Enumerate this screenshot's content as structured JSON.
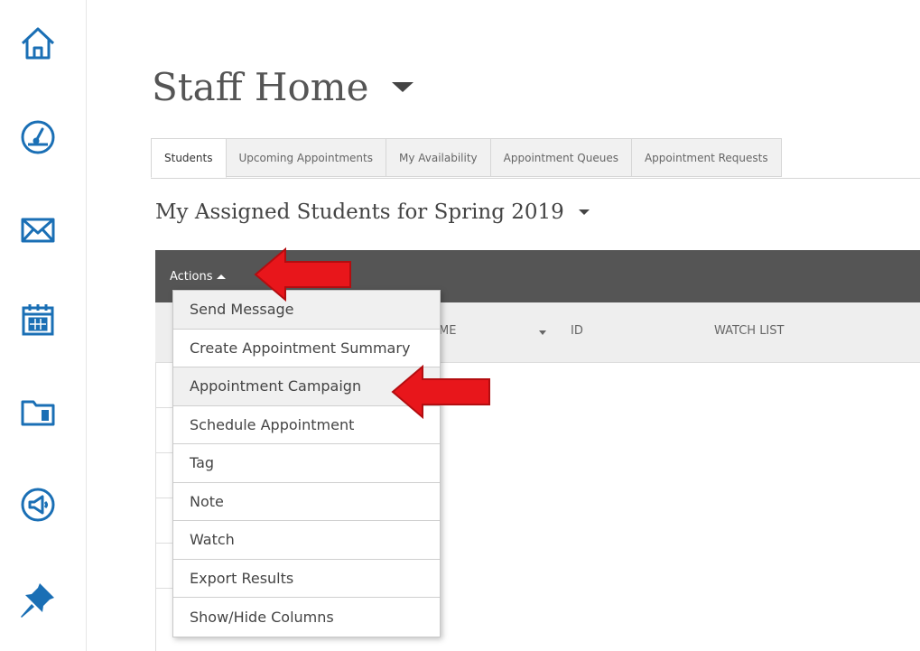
{
  "nav": {
    "icons": [
      "home-icon",
      "dashboard-icon",
      "mail-icon",
      "calendar-icon",
      "folder-icon",
      "megaphone-icon",
      "pin-icon"
    ],
    "icon_color": "#1a6fb5"
  },
  "page": {
    "title": "Staff Home"
  },
  "tabs": [
    {
      "label": "Students",
      "active": true
    },
    {
      "label": "Upcoming Appointments",
      "active": false
    },
    {
      "label": "My Availability",
      "active": false
    },
    {
      "label": "Appointment Queues",
      "active": false
    },
    {
      "label": "Appointment Requests",
      "active": false
    }
  ],
  "section": {
    "subtitle": "My Assigned Students for Spring 2019"
  },
  "actions": {
    "label": "Actions",
    "menu_items": [
      "Send Message",
      "Create Appointment Summary",
      "Appointment Campaign",
      "Schedule Appointment",
      "Tag",
      "Note",
      "Watch",
      "Export Results",
      "Show/Hide Columns"
    ]
  },
  "table": {
    "columns": {
      "name_partial": "ME",
      "id": "ID",
      "watch_list": "WATCH LIST"
    }
  },
  "colors": {
    "actions_bar": "#555555",
    "annotation_arrow": "#e8161b"
  }
}
